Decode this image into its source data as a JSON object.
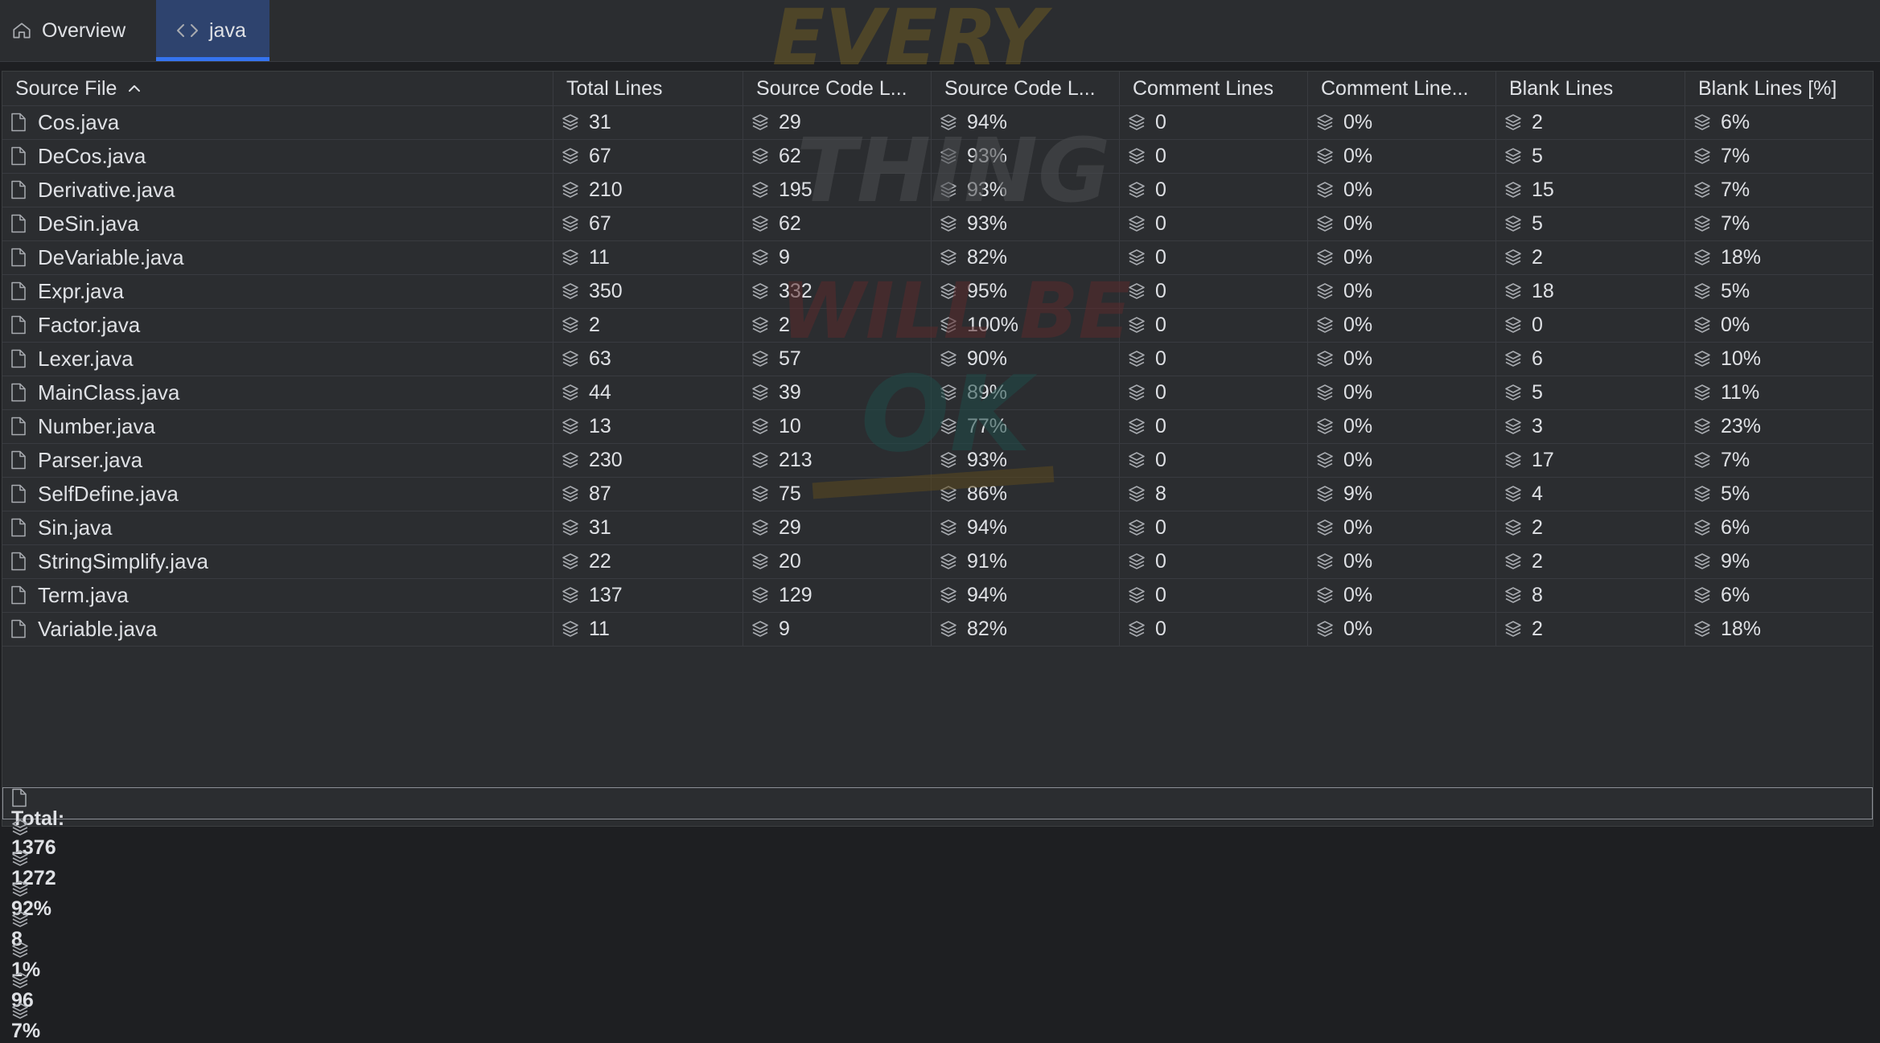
{
  "tabs": [
    {
      "label": "Overview",
      "icon": "home-icon"
    },
    {
      "label": "java",
      "icon": "code-icon"
    }
  ],
  "watermark_text": [
    "EVERY",
    "THING",
    "WILL BE",
    "OK"
  ],
  "table": {
    "columns": [
      "Source File",
      "Total Lines",
      "Source Code L...",
      "Source Code L...",
      "Comment Lines",
      "Comment Line...",
      "Blank Lines",
      "Blank Lines [%]"
    ],
    "sort_indicator": "^",
    "rows": [
      {
        "file": "Cos.java",
        "values": [
          "31",
          "29",
          "94%",
          "0",
          "0%",
          "2",
          "6%"
        ]
      },
      {
        "file": "DeCos.java",
        "values": [
          "67",
          "62",
          "93%",
          "0",
          "0%",
          "5",
          "7%"
        ]
      },
      {
        "file": "Derivative.java",
        "values": [
          "210",
          "195",
          "93%",
          "0",
          "0%",
          "15",
          "7%"
        ]
      },
      {
        "file": "DeSin.java",
        "values": [
          "67",
          "62",
          "93%",
          "0",
          "0%",
          "5",
          "7%"
        ]
      },
      {
        "file": "DeVariable.java",
        "values": [
          "11",
          "9",
          "82%",
          "0",
          "0%",
          "2",
          "18%"
        ]
      },
      {
        "file": "Expr.java",
        "values": [
          "350",
          "332",
          "95%",
          "0",
          "0%",
          "18",
          "5%"
        ]
      },
      {
        "file": "Factor.java",
        "values": [
          "2",
          "2",
          "100%",
          "0",
          "0%",
          "0",
          "0%"
        ]
      },
      {
        "file": "Lexer.java",
        "values": [
          "63",
          "57",
          "90%",
          "0",
          "0%",
          "6",
          "10%"
        ]
      },
      {
        "file": "MainClass.java",
        "values": [
          "44",
          "39",
          "89%",
          "0",
          "0%",
          "5",
          "11%"
        ]
      },
      {
        "file": "Number.java",
        "values": [
          "13",
          "10",
          "77%",
          "0",
          "0%",
          "3",
          "23%"
        ]
      },
      {
        "file": "Parser.java",
        "values": [
          "230",
          "213",
          "93%",
          "0",
          "0%",
          "17",
          "7%"
        ]
      },
      {
        "file": "SelfDefine.java",
        "values": [
          "87",
          "75",
          "86%",
          "8",
          "9%",
          "4",
          "5%"
        ]
      },
      {
        "file": "Sin.java",
        "values": [
          "31",
          "29",
          "94%",
          "0",
          "0%",
          "2",
          "6%"
        ]
      },
      {
        "file": "StringSimplify.java",
        "values": [
          "22",
          "20",
          "91%",
          "0",
          "0%",
          "2",
          "9%"
        ]
      },
      {
        "file": "Term.java",
        "values": [
          "137",
          "129",
          "94%",
          "0",
          "0%",
          "8",
          "6%"
        ]
      },
      {
        "file": "Variable.java",
        "values": [
          "11",
          "9",
          "82%",
          "0",
          "0%",
          "2",
          "18%"
        ]
      }
    ],
    "total": {
      "label": "Total:",
      "values": [
        "1376",
        "1272",
        "92%",
        "8",
        "1%",
        "96",
        "7%"
      ]
    }
  },
  "colors": {
    "background": "#1e1f22",
    "panel": "#2b2d30",
    "selected_tab": "#2e436e",
    "accent": "#3574f0",
    "text": "#dfe1e5",
    "icon": "#a8abb0"
  }
}
